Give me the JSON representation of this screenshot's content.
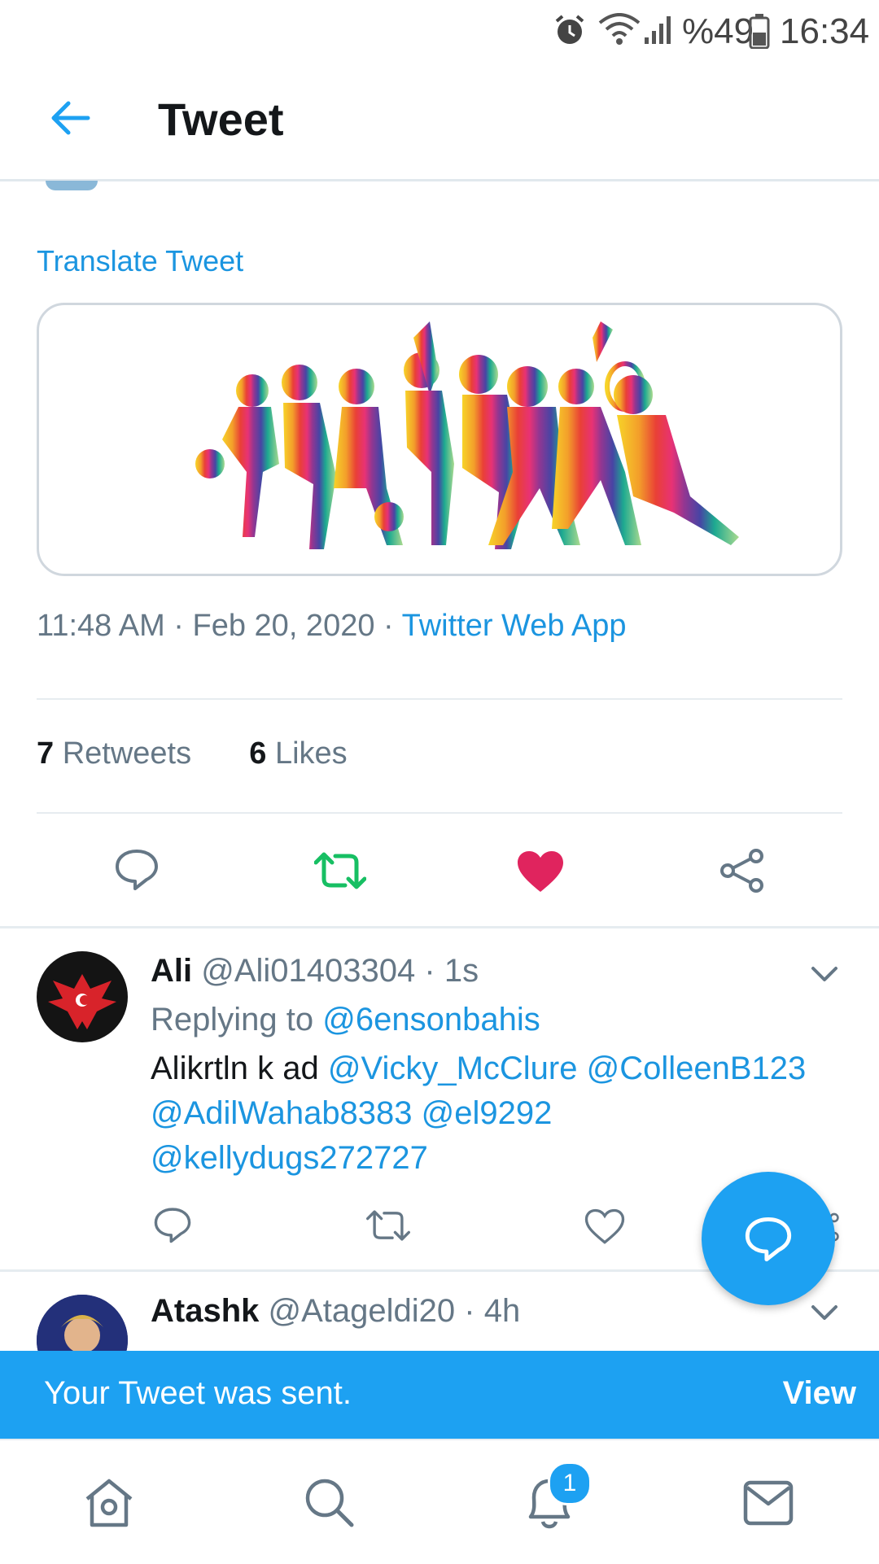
{
  "status_bar": {
    "battery": "%49",
    "time": "16:34",
    "icons": [
      "alarm-icon",
      "wifi-icon",
      "signal-icon",
      "battery-icon"
    ]
  },
  "header": {
    "title": "Tweet"
  },
  "tweet": {
    "translate_label": "Translate Tweet",
    "time": "11:48 AM",
    "date": "Feb 20, 2020",
    "source": "Twitter Web App",
    "retweets_count": "7",
    "retweets_label": "Retweets",
    "likes_count": "6",
    "likes_label": "Likes"
  },
  "replies": [
    {
      "name": "Ali",
      "handle": "@Ali01403304",
      "time": "1s",
      "replying_label": "Replying to",
      "replying_to": "@6ensonbahis",
      "text_prefix": "Alikrtln k ad",
      "mentions_line1": [
        "@Vicky_McClure",
        "@ColleenB123"
      ],
      "mentions_line2": [
        "@AdilWahab8383",
        "@el9292"
      ],
      "mentions_line3": [
        "@kellydugs272727"
      ]
    },
    {
      "name": "Atashk",
      "handle": "@Atageldi20",
      "time": "4h"
    }
  ],
  "toast": {
    "message": "Your Tweet was sent.",
    "action": "View"
  },
  "bottom_nav": {
    "notification_badge": "1"
  },
  "colors": {
    "accent": "#1da1f2",
    "retweet_green": "#17bf63",
    "like_red": "#e0245e",
    "toast_bg": "#1da1f2"
  }
}
